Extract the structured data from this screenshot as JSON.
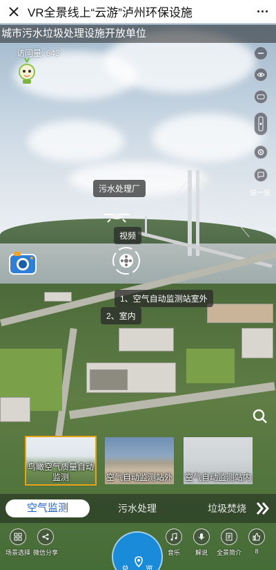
{
  "topbar": {
    "title": "VR全景线上“云游”泸州环保设施"
  },
  "banner": {
    "text": "城市污水垃圾处理设施开放单位"
  },
  "visits": {
    "text": "访问量: 643"
  },
  "right_tools": {
    "say_label": "说一说"
  },
  "hotspots": {
    "plant_label": "污水处理厂",
    "video_label": "视频",
    "station_outdoor": "1、空气自动监测站室外",
    "station_indoor": "2、室内"
  },
  "thumbnails": [
    {
      "caption": "鸟瞰空气质量自动监测",
      "selected": true
    },
    {
      "caption": "空气自动监测站外",
      "selected": false
    },
    {
      "caption": "空气自动监测站内",
      "selected": false
    }
  ],
  "categories": [
    {
      "label": "空气监测",
      "active": true
    },
    {
      "label": "污水处理",
      "active": false
    },
    {
      "label": "垃圾焚烧",
      "active": false
    }
  ],
  "bottom": {
    "scene_select": "场景选择",
    "wechat_share": "微信分享",
    "overview_left": "总",
    "overview_right": "览",
    "music": "音乐",
    "narration": "解说",
    "intro": "全景简介",
    "likes": "8"
  },
  "colors": {
    "accent": "#1a8bd8",
    "selected_border": "#e8a317",
    "active_tab_text": "#1e5fc5"
  }
}
